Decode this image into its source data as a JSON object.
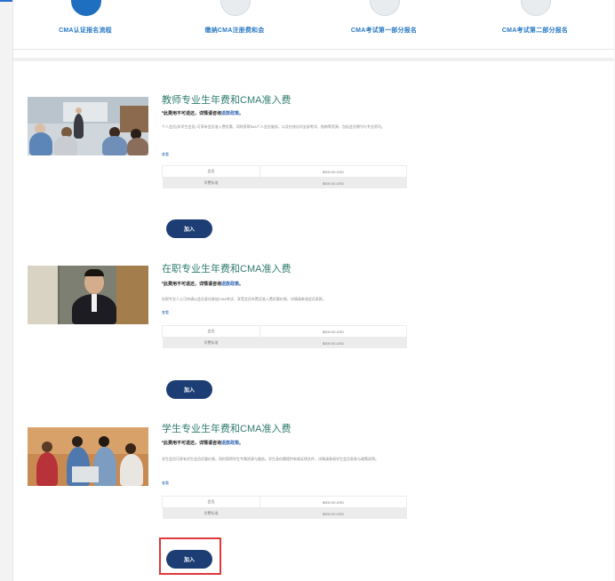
{
  "steps": [
    {
      "label": "CMA认证报名流程",
      "active": true
    },
    {
      "label": "缴纳CMA注册费和会",
      "active": false
    },
    {
      "label": "CMA考试第一部分报名",
      "active": false
    },
    {
      "label": "CMA考试第二部分报名",
      "active": false
    }
  ],
  "sections": [
    {
      "title": "教师专业生年费和CMA准入费",
      "notice_prefix": "*此费用不可退还，详情请咨询",
      "notice_link": "退款政策。",
      "description": "个人会员(非学生会员) 可享有会员准入费优惠，同时获得IMA个人会员服务，以及在线访问全部考试、指南等资源，包括会员期刊与专业资讯。",
      "link_label": "查看",
      "fees": [
        [
          "会员",
          "$000.00 USD"
        ],
        [
          "学费标准",
          "$000.00 USD"
        ]
      ],
      "join_label": "加入",
      "highlighted": false
    },
    {
      "title": "在职专业生年费和CMA准入费",
      "notice_prefix": "*此费用不可退还，详情请咨询",
      "notice_link": "退款政策。",
      "description": "在职专业人士可申请以会员身份参加CMA考试，享受会员年费及准入费优惠价格，详情请参阅会员条款。",
      "link_label": "查看",
      "fees": [
        [
          "会员",
          "$000.00 USD"
        ],
        [
          "学费标准",
          "$000.00 USD"
        ]
      ],
      "join_label": "加入",
      "highlighted": false
    },
    {
      "title": "学生专业生年费和CMA准入费",
      "notice_prefix": "*此费用不可退还，详情请咨询",
      "notice_link": "退款政策。",
      "description": "学生会员可享有学生会员优惠价格，同时获得学生专属资源与服务。学生身份需提供有效证明文件，详情请参阅学生会员条款与政策说明。",
      "link_label": "查看",
      "fees": [
        [
          "会员",
          "$000.00 USD"
        ],
        [
          "学费标准",
          "$000.00 USD"
        ]
      ],
      "join_label": "加入",
      "highlighted": true
    }
  ]
}
